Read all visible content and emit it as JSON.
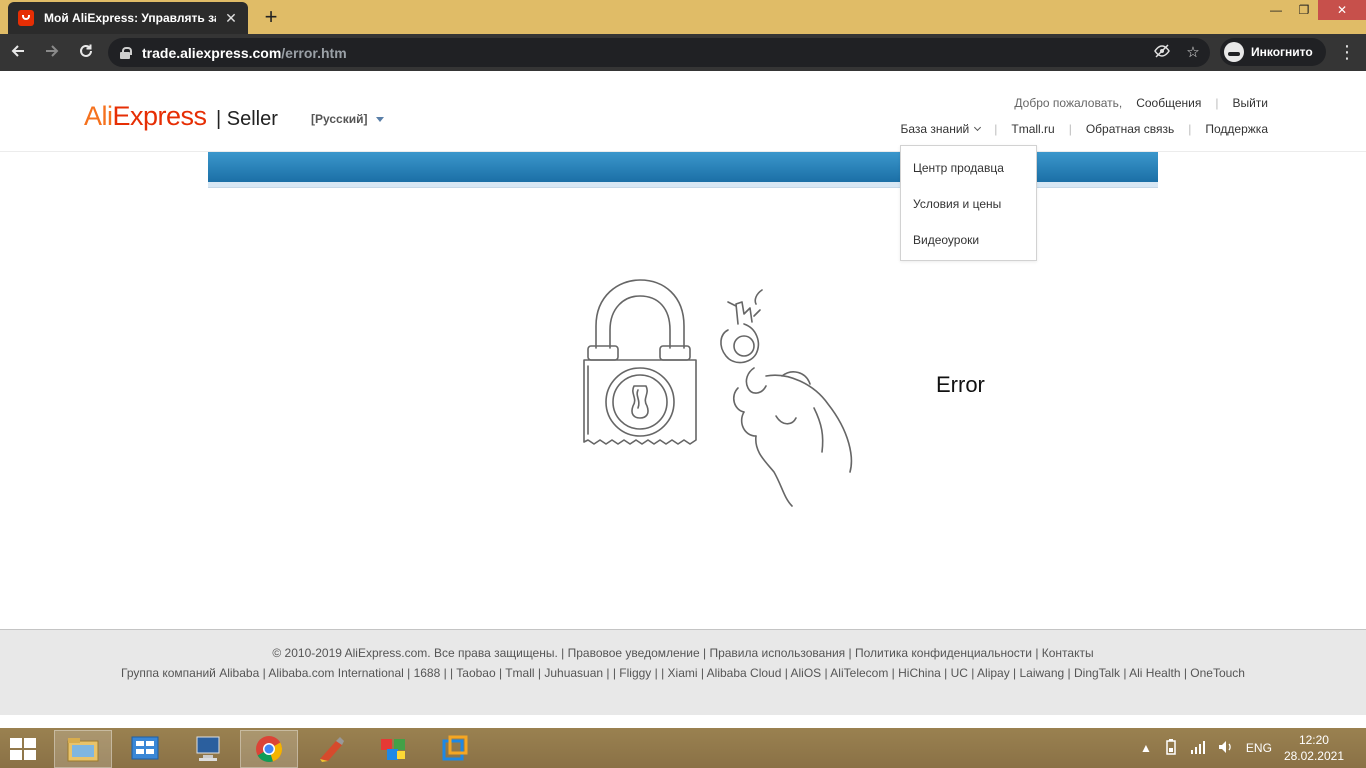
{
  "browser": {
    "tab_title": "Мой AliExpress: Управлять зак",
    "tab_close": "✕",
    "new_tab": "+",
    "url_host": "trade.aliexpress.com",
    "url_path": "/error.htm",
    "incognito_label": "Инкогнито",
    "window_controls": {
      "minimize": "—",
      "restore": "❐",
      "close": "✕"
    }
  },
  "header": {
    "logo_ali": "Ali",
    "logo_express": "Express",
    "seller": "| Seller",
    "language": "[Русский]",
    "welcome": "Добро пожаловать,",
    "messages": "Сообщения",
    "logout": "Выйти",
    "knowledge_base": "База знаний",
    "tmall": "Tmall.ru",
    "feedback": "Обратная связь",
    "support": "Поддержка"
  },
  "dropdown": {
    "items": [
      "Центр продавца",
      "Условия и цены",
      "Видеоуроки"
    ]
  },
  "main": {
    "error": "Error"
  },
  "footer": {
    "line1": "© 2010-2019 AliExpress.com. Все права защищены. | Правовое уведомление | Правила использования | Политика конфиденциальности | Контакты",
    "line2": "Группа компаний Alibaba | Alibaba.com International | 1688 | | Taobao | Tmall | Juhuasuan | | Fliggy | | Xiami | Alibaba Cloud | AliOS | AliTelecom | HiChina | UC | Alipay | Laiwang | DingTalk | Ali Health | OneTouch"
  },
  "taskbar": {
    "language": "ENG",
    "time": "12:20",
    "date": "28.02.2021"
  }
}
